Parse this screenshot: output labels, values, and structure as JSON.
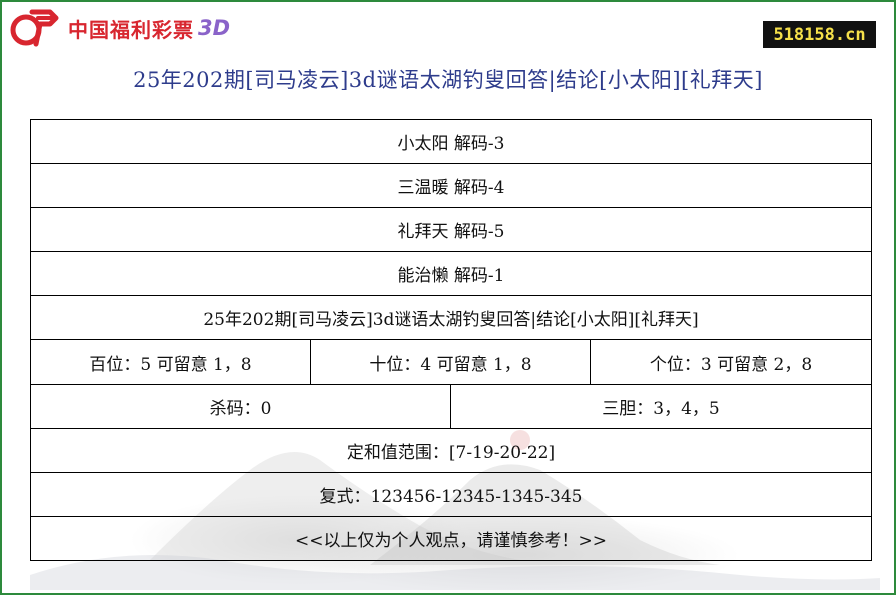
{
  "header": {
    "logo_text": "中国福利彩票",
    "logo_3d": "3D",
    "site_badge": "518158.cn"
  },
  "title": "25年202期[司马凌云]3d谜语太湖钓叟回答|结论[小太阳][礼拜天]",
  "rows": {
    "decode_1": "小太阳 解码-3",
    "decode_2": "三温暖 解码-4",
    "decode_3": "礼拜天 解码-5",
    "decode_4": "能治懒 解码-1",
    "summary": "25年202期[司马凌云]3d谜语太湖钓叟回答|结论[小太阳][礼拜天]",
    "hundreds": "百位：5 可留意 1，8",
    "tens": "十位：4 可留意 1，8",
    "units": "个位：3 可留意 2，8",
    "kill": "杀码：0",
    "three_bold": "三胆：3，4，5",
    "sum_range": "定和值范围：[7-19-20-22]",
    "combo": "复式：123456-12345-1345-345",
    "disclaimer": "<<以上仅为个人观点，请谨慎参考！>>"
  },
  "colors": {
    "border": "#2d8a3c",
    "title": "#2e3c8c",
    "logo_red": "#d8262f",
    "logo_purple": "#8a63c9",
    "badge_bg": "#111111",
    "badge_text": "#f5e04a"
  }
}
